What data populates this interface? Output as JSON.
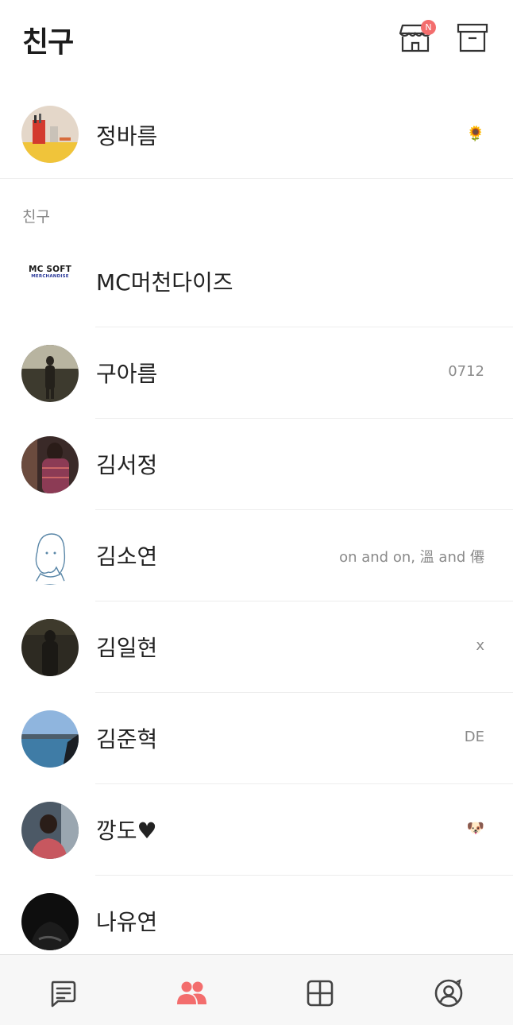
{
  "header": {
    "title": "친구",
    "store_badge": "N"
  },
  "my_profile": {
    "name": "정바름",
    "status": "🌻"
  },
  "section": {
    "friends_label": "친구"
  },
  "friends": [
    {
      "name": "MC머천다이즈",
      "status": "",
      "logo_line1": "MC SOFT",
      "logo_line2": "MERCHANDISE"
    },
    {
      "name": "구아름",
      "status": "0712"
    },
    {
      "name": "김서정",
      "status": ""
    },
    {
      "name": "김소연",
      "status": "on and on, 溫 and 僊"
    },
    {
      "name": "김일현",
      "status": "x"
    },
    {
      "name": "김준혁",
      "status": "DE"
    },
    {
      "name": "깡도♥",
      "status": "🐶"
    },
    {
      "name": "나유연",
      "status": ""
    }
  ],
  "bottom_nav": [
    {
      "icon": "chat-icon"
    },
    {
      "icon": "friends-icon",
      "active": true
    },
    {
      "icon": "grid-icon"
    },
    {
      "icon": "profile-icon"
    }
  ],
  "colors": {
    "accent": "#f36d6d",
    "nav_icon": "#444444",
    "background": "#ffffff",
    "nav_background": "#f7f7f7"
  }
}
